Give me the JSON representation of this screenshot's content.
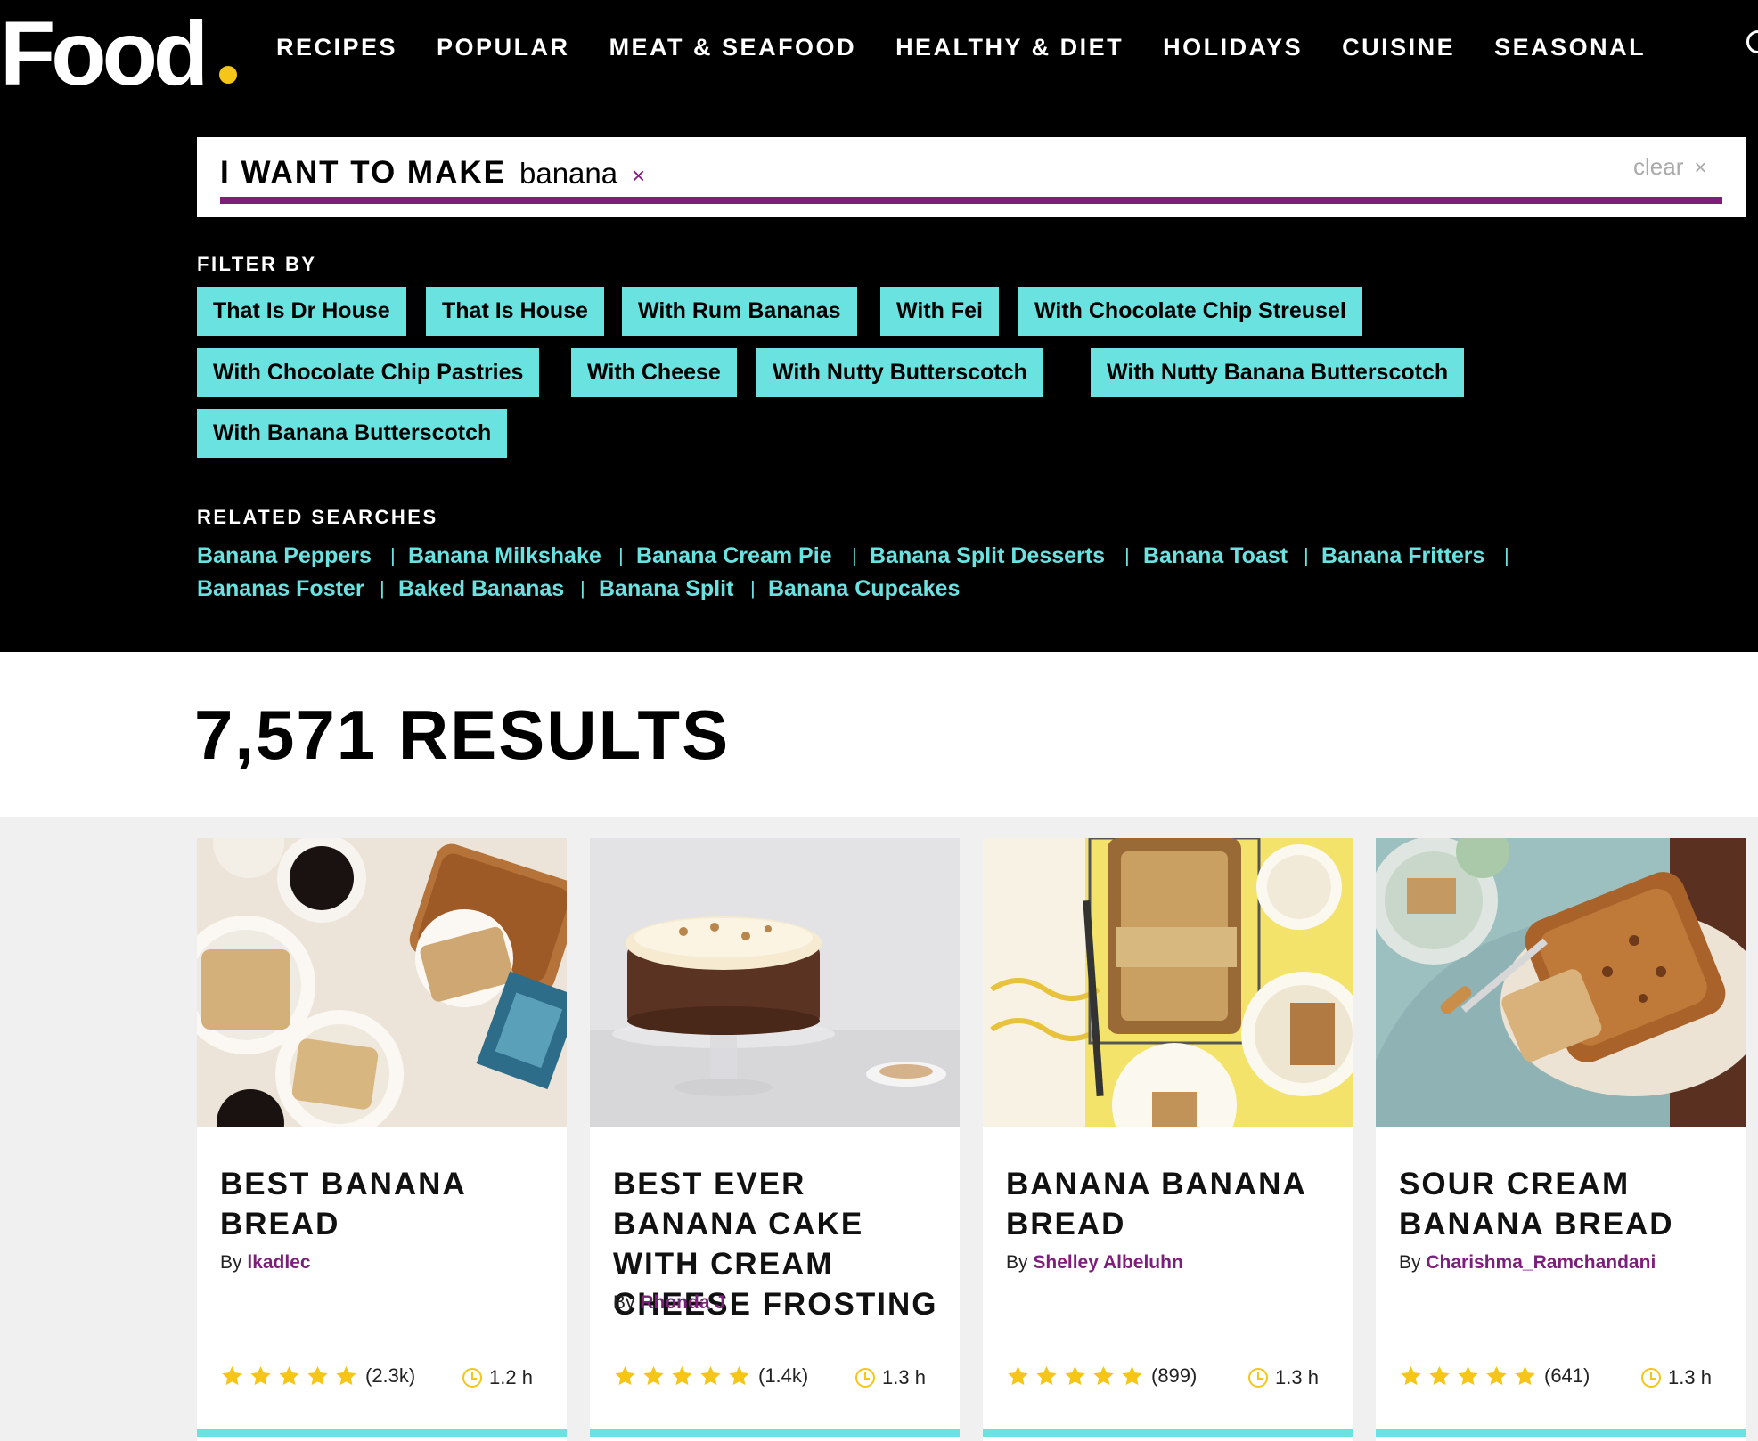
{
  "header": {
    "logo_text": "Food",
    "nav": [
      "RECIPES",
      "POPULAR",
      "MEAT & SEAFOOD",
      "HEALTHY & DIET",
      "HOLIDAYS",
      "CUISINE",
      "SEASONAL"
    ]
  },
  "search": {
    "label": "I WANT TO MAKE",
    "term": "banana",
    "term_remove": "×",
    "clear_label": "clear",
    "clear_icon": "×"
  },
  "filter": {
    "label": "FILTER BY",
    "chips": [
      "That Is Dr House",
      "That Is House",
      "With Rum Bananas",
      "With Fei",
      "With Chocolate Chip Streusel",
      "With Chocolate Chip Pastries",
      "With Cheese",
      "With Nutty Butterscotch",
      "With Nutty Banana Butterscotch",
      "With Banana Butterscotch"
    ]
  },
  "related": {
    "label": "RELATED SEARCHES",
    "links": [
      "Banana Peppers",
      "Banana Milkshake",
      "Banana Cream Pie",
      "Banana Split Desserts",
      "Banana Toast",
      "Banana Fritters",
      "Bananas Foster",
      "Baked Bananas",
      "Banana Split",
      "Banana Cupcakes"
    ],
    "separator": "|"
  },
  "results": {
    "count_text": "7,571 RESULTS"
  },
  "by_label": "By",
  "cards": [
    {
      "title": "BEST BANANA BREAD",
      "author": "lkadlec",
      "rating_count": "(2.3k)",
      "time": "1.2 h",
      "stars": 5
    },
    {
      "title": "BEST EVER BANANA CAKE WITH CREAM CHEESE FROSTING",
      "author": "Rhonda J",
      "rating_count": "(1.4k)",
      "time": "1.3 h",
      "stars": 5
    },
    {
      "title": "BANANA BANANA BREAD",
      "author": "Shelley Albeluhn",
      "rating_count": "(899)",
      "time": "1.3 h",
      "stars": 5
    },
    {
      "title": "SOUR CREAM BANANA BREAD",
      "author": "Charishma_Ramchandani",
      "rating_count": "(641)",
      "time": "1.3 h",
      "stars": 5
    }
  ],
  "colors": {
    "accent_purple": "#7d1f7a",
    "chip_teal": "#6ae2e0",
    "star_yellow": "#f5c518",
    "header_bg": "#000000"
  }
}
